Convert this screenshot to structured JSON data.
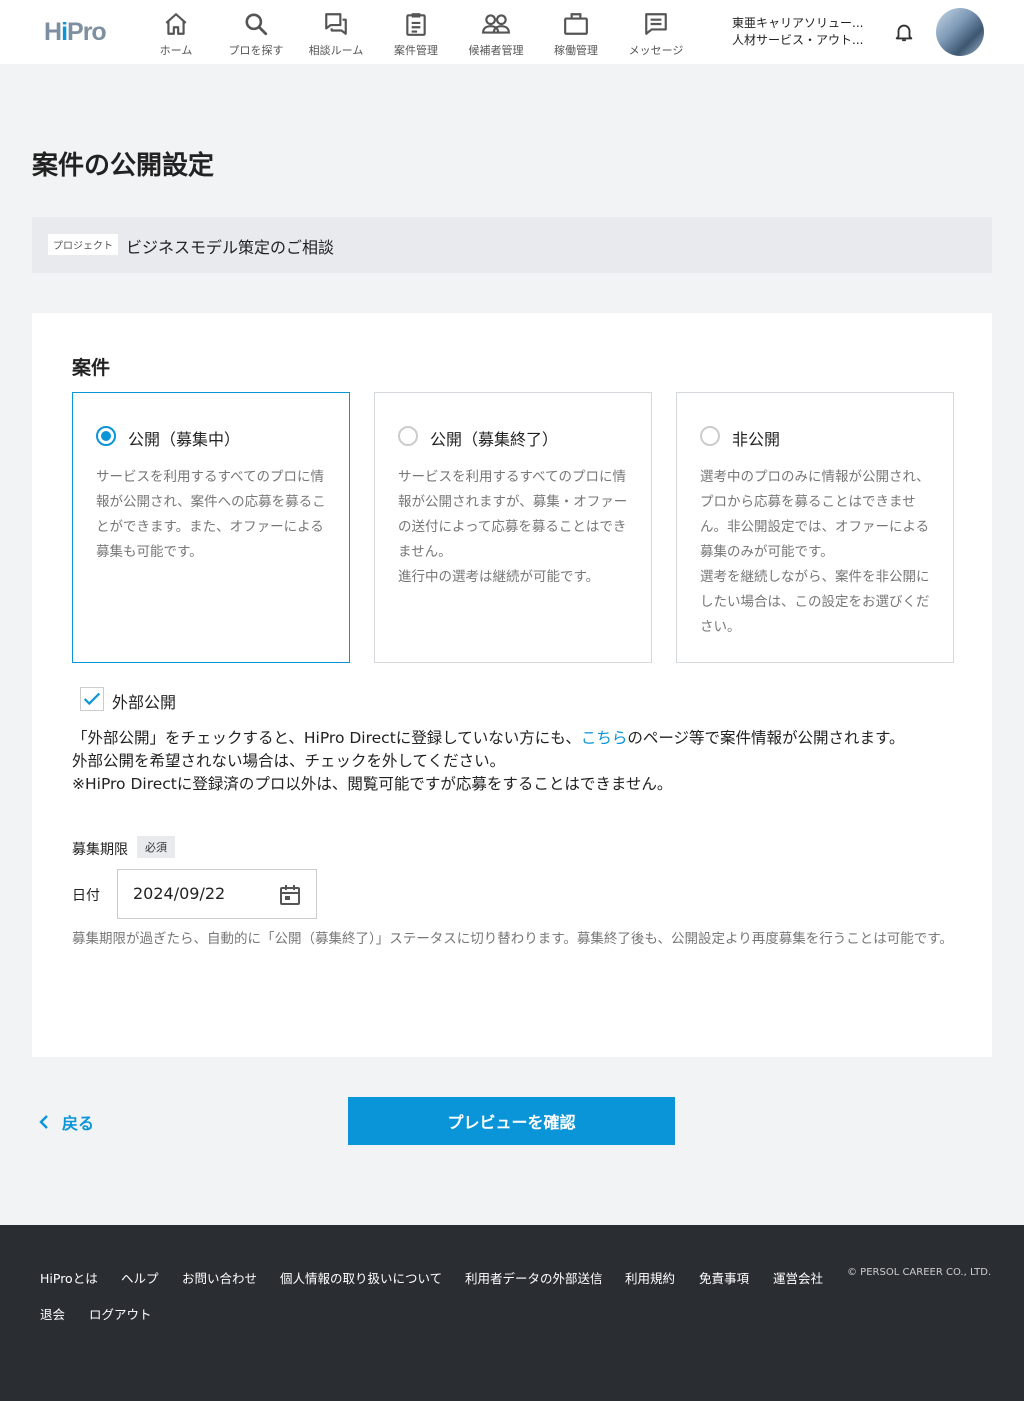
{
  "header": {
    "logo": "HiPro",
    "nav": [
      {
        "label": "ホーム",
        "icon": "home-icon"
      },
      {
        "label": "プロを探す",
        "icon": "search-icon"
      },
      {
        "label": "相談ルーム",
        "icon": "chat-icon"
      },
      {
        "label": "案件管理",
        "icon": "clipboard-icon"
      },
      {
        "label": "候補者管理",
        "icon": "people-icon"
      },
      {
        "label": "稼働管理",
        "icon": "briefcase-icon"
      },
      {
        "label": "メッセージ",
        "icon": "message-icon"
      }
    ],
    "company_line1": "東亜キャリアソリュー...",
    "company_line2": "人材サービス・アウト..."
  },
  "page": {
    "title": "案件の公開設定",
    "project_tag": "プロジェクト",
    "project_name": "ビジネスモデル策定のご相談"
  },
  "form": {
    "section_title": "案件",
    "options": [
      {
        "title": "公開（募集中）",
        "selected": true,
        "desc": "サービスを利用するすべてのプロに情報が公開され、案件への応募を募ることができます。また、オファーによる募集も可能です。"
      },
      {
        "title": "公開（募集終了）",
        "selected": false,
        "desc": "サービスを利用するすべてのプロに情報が公開されますが、募集・オファーの送付によって応募を募ることはできません。\n進行中の選考は継続が可能です。"
      },
      {
        "title": "非公開",
        "selected": false,
        "desc": "選考中のプロのみに情報が公開され、プロから応募を募ることはできません。非公開設定では、オファーによる募集のみが可能です。\n選考を継続しながら、案件を非公開にしたい場合は、この設定をお選びください。"
      }
    ],
    "external": {
      "label": "外部公開",
      "checked": true,
      "text_before": "「外部公開」をチェックすると、HiPro Directに登録していない方にも、",
      "link": "こちら",
      "text_after": "のページ等で案件情報が公開されます。",
      "line2": "外部公開を希望されない場合は、チェックを外してください。",
      "line3": "※HiPro Directに登録済のプロ以外は、閲覧可能ですが応募をすることはできません。"
    },
    "deadline": {
      "label": "募集期限",
      "required": "必須",
      "date_label": "日付",
      "date_value": "2024/09/22",
      "note": "募集期限が過ぎたら、自動的に「公開（募集終了）」ステータスに切り替わります。募集終了後も、公開設定より再度募集を行うことは可能です。"
    }
  },
  "actions": {
    "back": "戻る",
    "preview": "プレビューを確認"
  },
  "footer": {
    "links": [
      "HiProとは",
      "ヘルプ",
      "お問い合わせ",
      "個人情報の取り扱いについて",
      "利用者データの外部送信",
      "利用規約",
      "免責事項",
      "運営会社",
      "退会",
      "ログアウト"
    ],
    "copyright": "© PERSOL CAREER CO., LTD."
  },
  "colors": {
    "accent": "#0a95d8",
    "footer_bg": "#2a2e33",
    "page_bg": "#f2f3f5"
  }
}
